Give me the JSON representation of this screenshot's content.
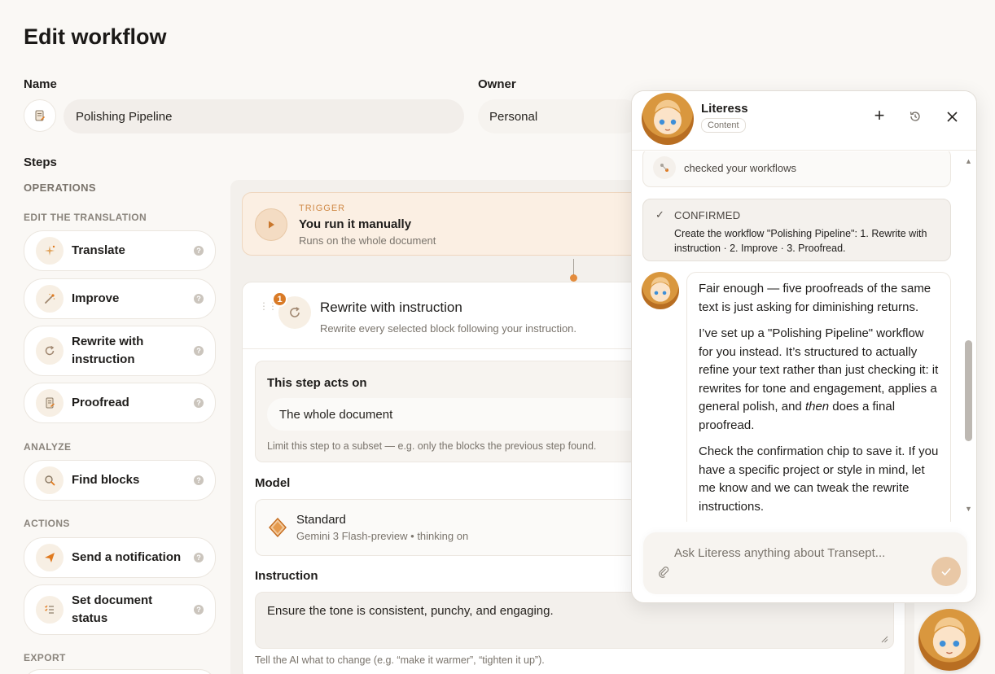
{
  "page": {
    "title": "Edit workflow"
  },
  "name_field": {
    "label": "Name",
    "value": "Polishing Pipeline"
  },
  "owner_field": {
    "label": "Owner",
    "value": "Personal"
  },
  "steps": {
    "label": "Steps",
    "operations_caption": "OPERATIONS",
    "groups": [
      {
        "caption": "EDIT THE TRANSLATION",
        "items": [
          {
            "label": "Translate",
            "icon": "sparkle-icon"
          },
          {
            "label": "Improve",
            "icon": "magic-wand-icon"
          },
          {
            "label": "Rewrite with instruction",
            "icon": "refresh-icon"
          },
          {
            "label": "Proofread",
            "icon": "document-check-icon"
          }
        ]
      },
      {
        "caption": "ANALYZE",
        "items": [
          {
            "label": "Find blocks",
            "icon": "search-icon"
          }
        ]
      },
      {
        "caption": "ACTIONS",
        "items": [
          {
            "label": "Send a notification",
            "icon": "send-icon"
          },
          {
            "label": "Set document status",
            "icon": "checklist-icon"
          }
        ]
      },
      {
        "caption": "EXPORT",
        "items": []
      }
    ],
    "help_glyph": "?"
  },
  "trigger": {
    "caption": "TRIGGER",
    "title": "You run it manually",
    "subtitle": "Runs on the whole document"
  },
  "step1": {
    "number": "1",
    "title": "Rewrite with instruction",
    "subtitle": "Rewrite every selected block following your instruction.",
    "acts_on": {
      "label": "This step acts on",
      "value": "The whole document",
      "hint": "Limit this step to a subset — e.g. only the blocks the previous step found."
    },
    "model": {
      "label": "Model",
      "name": "Standard",
      "detail": "Gemini 3 Flash-preview • thinking on"
    },
    "instruction": {
      "label": "Instruction",
      "value": "Ensure the tone is consistent, punchy, and engaging.",
      "hint": "Tell the AI what to change (e.g. “make it warmer”, “tighten it up”)."
    }
  },
  "assistant": {
    "name": "Literess",
    "badge": "Content",
    "activity": "checked your workflows",
    "confirmed": {
      "label": "CONFIRMED",
      "text": "Create the workflow \"Polishing Pipeline\": 1. Rewrite with instruction · 2. Improve · 3. Proofread."
    },
    "message": {
      "p1": "Fair enough — five proofreads of the same text is just asking for diminishing returns.",
      "p2_a": "I’ve set up a \"Polishing Pipeline\" workflow for you instead. It’s structured to actually refine your text rather than just checking it: it rewrites for tone and engagement, applies a general polish, and ",
      "p2_em": "then",
      "p2_b": " does a final proofread.",
      "p3": "Check the confirmation chip to save it. If you have a specific project or style in mind, let me know and we can tweak the rewrite instructions."
    },
    "input_placeholder": "Ask Literess anything about Transept..."
  },
  "colors": {
    "accent": "#e07a1f",
    "trigger_bg": "#fbefe3",
    "page_bg": "#faf8f5"
  }
}
